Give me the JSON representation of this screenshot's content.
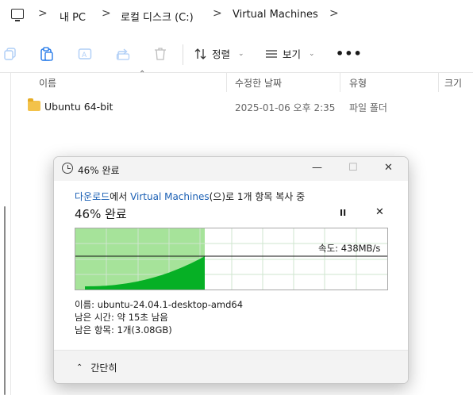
{
  "breadcrumb": {
    "items": [
      "내 PC",
      "로컬 디스크 (C:)",
      "Virtual Machines"
    ],
    "separator": ">"
  },
  "toolbar": {
    "icons": [
      "copy-icon",
      "paste-icon",
      "rename-icon",
      "share-icon",
      "delete-icon"
    ],
    "sort_label": "정렬",
    "view_label": "보기",
    "more_label": "•••"
  },
  "columns": {
    "name": "이름",
    "modified": "수정한 날짜",
    "type": "유형",
    "size": "크기"
  },
  "files": [
    {
      "name": "Ubuntu 64-bit",
      "modified": "2025-01-06 오후 2:35",
      "type": "파일 폴더"
    }
  ],
  "dialog": {
    "title": "46% 완료",
    "source": "다운로드",
    "from_suffix": "에서 ",
    "destination": "Virtual Machines",
    "copy_suffix": "(으)로 1개 항목 복사 중",
    "progress_title": "46% 완료",
    "progress": 0.46,
    "speed": "속도: 438MB/s",
    "name_line": "이름: ubuntu-24.04.1-desktop-amd64",
    "time_line": "남은 시간: 약 15초 남음",
    "items_line": "남은 항목: 1개(3.08GB)",
    "less_details": "간단히",
    "pause": "II",
    "cancel": "✕"
  },
  "colors": {
    "link": "#1a5fb4",
    "progress_fill": "#a6e39a",
    "speed_fill": "#06b025",
    "folder": "#f3c24a"
  }
}
